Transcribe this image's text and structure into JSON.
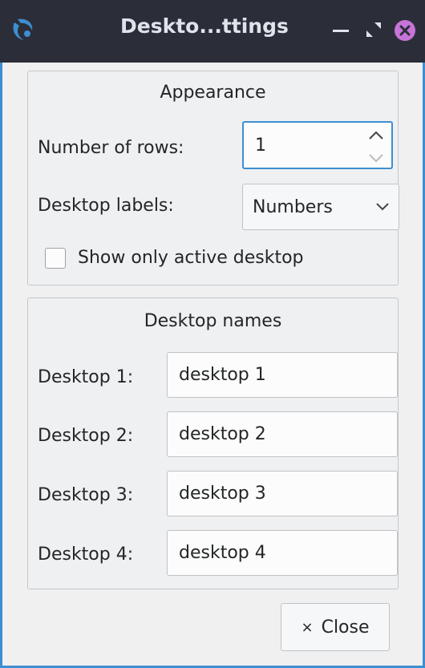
{
  "window": {
    "title": "Deskto...ttings",
    "minimize_glyph": "–",
    "colors": {
      "titlebar": "#2b2e39",
      "accent": "#3d8fd1",
      "close": "#c674d8"
    }
  },
  "appearance": {
    "title": "Appearance",
    "rows_label": "Number of rows:",
    "rows_value": "1",
    "labels_label": "Desktop labels:",
    "labels_value": "Numbers",
    "show_active_label": "Show only active desktop",
    "show_active_checked": false
  },
  "desktop_names": {
    "title": "Desktop names",
    "entries": [
      {
        "label": "Desktop 1:",
        "value": "desktop 1"
      },
      {
        "label": "Desktop 2:",
        "value": "desktop 2"
      },
      {
        "label": "Desktop 3:",
        "value": "desktop 3"
      },
      {
        "label": "Desktop 4:",
        "value": "desktop 4"
      }
    ]
  },
  "footer": {
    "close_icon": "×",
    "close_label": "Close"
  },
  "icons": {
    "app": "app-logo-icon",
    "minimize": "minimize-icon",
    "maximize": "maximize-icon",
    "close": "close-window-icon",
    "spin": "spin-arrows-icon",
    "combo": "chevron-down-icon"
  }
}
